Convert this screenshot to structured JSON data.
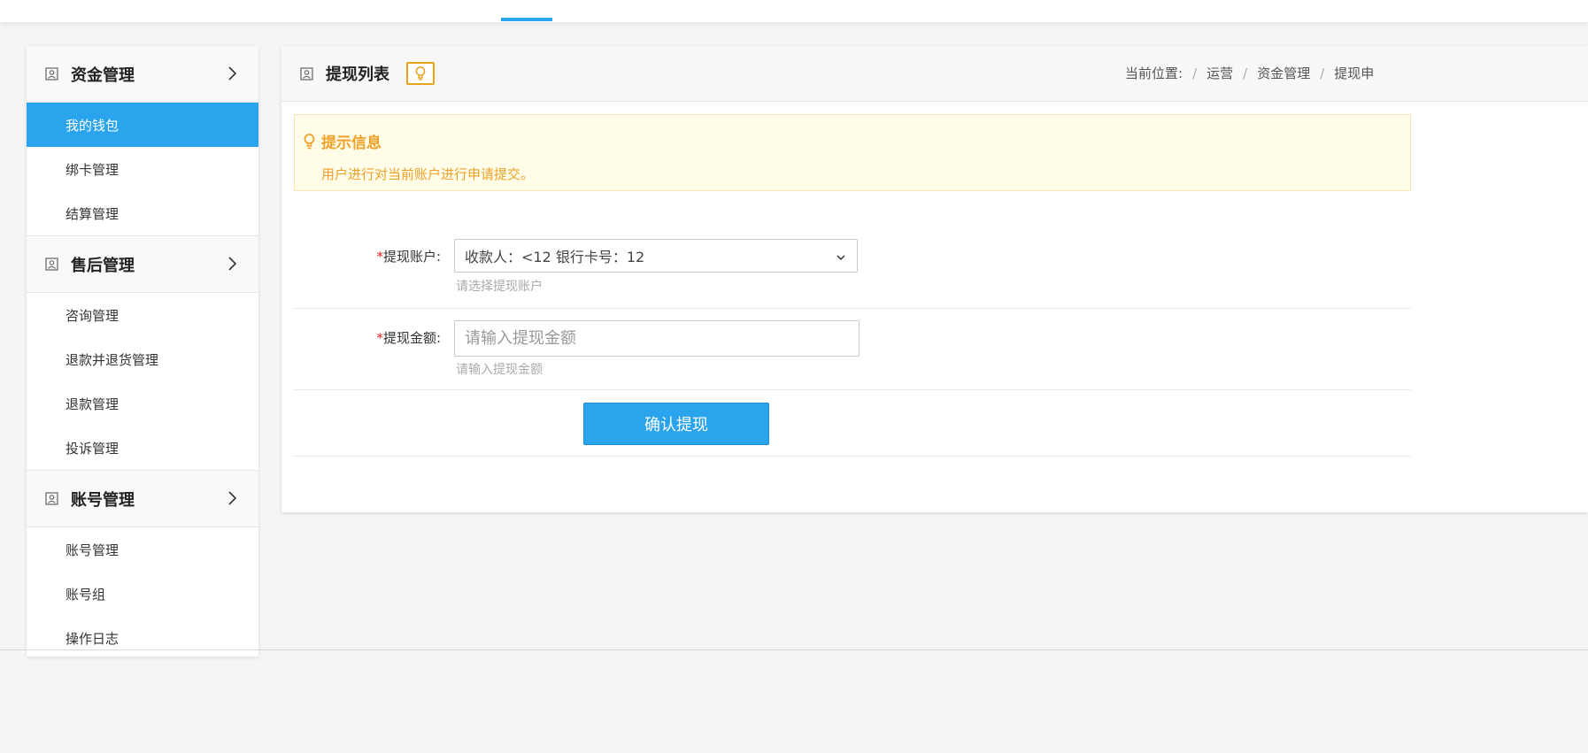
{
  "sidebar": {
    "groups": [
      {
        "title": "资金管理",
        "items": [
          {
            "label": "我的钱包",
            "active": true
          },
          {
            "label": "绑卡管理"
          },
          {
            "label": "结算管理"
          }
        ]
      },
      {
        "title": "售后管理",
        "items": [
          {
            "label": "咨询管理"
          },
          {
            "label": "退款并退货管理"
          },
          {
            "label": "退款管理"
          },
          {
            "label": "投诉管理"
          }
        ]
      },
      {
        "title": "账号管理",
        "items": [
          {
            "label": "账号管理"
          },
          {
            "label": "账号组"
          },
          {
            "label": "操作日志"
          }
        ]
      }
    ]
  },
  "content": {
    "title": "提现列表",
    "breadcrumb": {
      "prefix": "当前位置:",
      "items": [
        "运营",
        "资金管理",
        "提现申"
      ]
    },
    "notice": {
      "title": "提示信息",
      "text": "用户进行对当前账户进行申请提交。"
    },
    "form": {
      "required_mark": "*",
      "account_label": "提现账户:",
      "account_value": "收款人：<12 银行卡号：12",
      "account_hint": "请选择提现账户",
      "amount_label": "提现金额:",
      "amount_placeholder": "请输入提现金额",
      "amount_hint": "请输入提现金额",
      "submit_label": "确认提现"
    }
  },
  "colors": {
    "accent": "#2ba4ee",
    "warning": "#f0a12a",
    "required": "#e02020"
  }
}
